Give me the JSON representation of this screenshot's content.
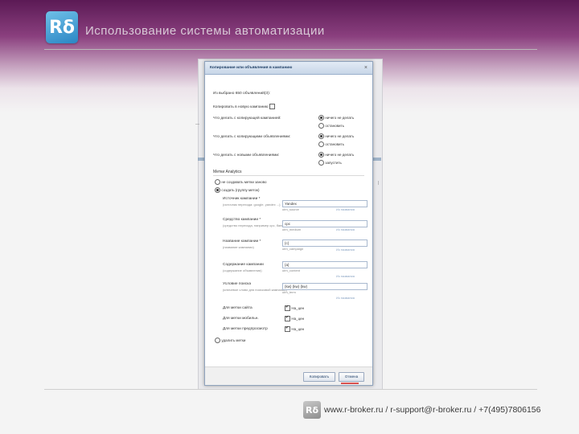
{
  "slide": {
    "logo_text": "Rδ",
    "title": "Использование системы автоматизации",
    "footer_logo_text": "Rδ",
    "contacts": "www.r-broker.ru / r-support@r-broker.ru / +7(495)7806156"
  },
  "modal": {
    "title": "Копирование или объявления в кампанию",
    "counter": "Из выбрано 650 объявлений(3):",
    "copy_to_new": "Копировать в новую кампанию",
    "rules": [
      {
        "label": "Что делать с копирующей кампанией:",
        "options": [
          "ничего не делать",
          "остановить"
        ],
        "selected": 0
      },
      {
        "label": "Что делать с копирующими объявлениями:",
        "options": [
          "ничего не делать",
          "остановить"
        ],
        "selected": 0
      },
      {
        "label": "Что делать с новыми объявлениями:",
        "options": [
          "ничего не делать",
          "запустить"
        ],
        "selected": 0
      }
    ],
    "analytics_title": "Метки Analytics",
    "analytics_options": [
      "не создавать метки заново",
      "создать (группу меток)"
    ],
    "fields": [
      {
        "label": "Источник кампании *",
        "hint": "(источник перехода: google, yandex ...)",
        "value": "Yandex",
        "param": "utm_source",
        "select": "Из названия"
      },
      {
        "label": "Средство кампании *",
        "hint": "(средство перехода, например cpc, баннер и т.д.)",
        "value": "cpc",
        "param": "utm_medium",
        "select": "Из названия"
      },
      {
        "label": "Название кампании *",
        "hint": "(название кампании)",
        "value": "{c}",
        "param": "utm_campaign",
        "select": "Из названия"
      },
      {
        "label": "Содержание кампании",
        "hint": "(содержание объявления)",
        "value": "{a}",
        "param": "utm_content",
        "select": "Из названия"
      },
      {
        "label": "Условие поиска",
        "hint": "(ключевое слово для поисковой кампании)",
        "value": "{kw} {kw} {kw}",
        "param": "utm_term",
        "select": "Из названия"
      }
    ],
    "extra_checks": [
      {
        "label": "Для метки сайта",
        "value": "На_цен",
        "checked": true
      },
      {
        "label": "Для метки мобильн.",
        "value": "На_цен",
        "checked": true
      },
      {
        "label": "Для метки предпросмотр",
        "value": "На_цен",
        "checked": true
      }
    ],
    "remove_option": "удалить метки",
    "buttons": {
      "copy": "Копировать",
      "cancel": "Отмена"
    }
  }
}
